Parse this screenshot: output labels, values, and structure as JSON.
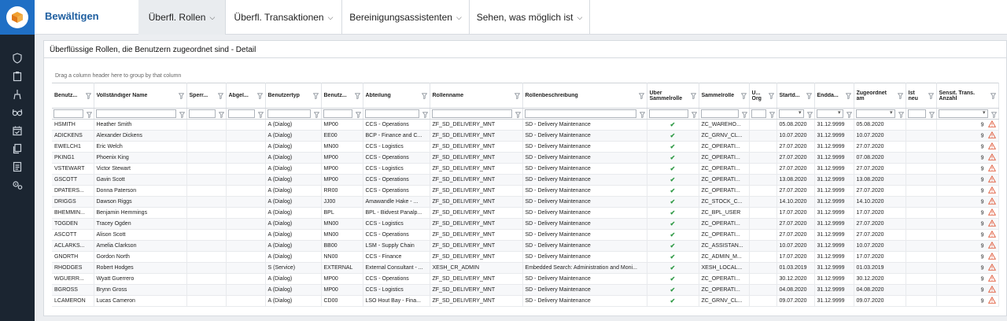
{
  "app": {
    "brand": "Bewältigen"
  },
  "nav": {
    "tabs": [
      {
        "label": "Überfl. Rollen"
      },
      {
        "label": "Überfl. Transaktionen"
      },
      {
        "label": "Bereinigungsassistenten"
      },
      {
        "label": "Sehen, was möglich ist"
      }
    ]
  },
  "sidebar": {
    "icons": [
      "shield-icon",
      "clipboard-icon",
      "broom-icon",
      "glasses-icon",
      "calendar-check-icon",
      "copy-icon",
      "report-icon",
      "gears-icon"
    ]
  },
  "panel": {
    "title": "Überflüssige Rollen, die Benutzern zugeordnet sind - Detail",
    "group_hint": "Drag a column header here to group by that column"
  },
  "table": {
    "columns": [
      {
        "label": "Benutz...",
        "w": 53
      },
      {
        "label": "Vollständiger Name",
        "w": 118
      },
      {
        "label": "Sperr...",
        "w": 50
      },
      {
        "label": "Abgel...",
        "w": 50
      },
      {
        "label": "Benutzertyp",
        "w": 71
      },
      {
        "label": "Benutz...",
        "w": 53
      },
      {
        "label": "Abteilung",
        "w": 85
      },
      {
        "label": "Rollenname",
        "w": 118
      },
      {
        "label": "Rollenbeschreibung",
        "w": 158
      },
      {
        "label": "Über Sammelrolle",
        "w": 66
      },
      {
        "label": "Sammelrolle",
        "w": 64
      },
      {
        "label": "Ü... Org",
        "w": 35
      },
      {
        "label": "Startd...",
        "w": 48
      },
      {
        "label": "Endda...",
        "w": 50
      },
      {
        "label": "Zugeordnet am",
        "w": 66
      },
      {
        "label": "Ist neu",
        "w": 39
      },
      {
        "label": "Sensit. Trans. Anzahl",
        "w": 79
      }
    ],
    "rows": [
      [
        "HSMITH",
        "Heather Smith",
        "",
        "",
        "A (Dialog)",
        "MP00",
        "CCS - Operations",
        "ZF_SD_DELIVERY_MNT",
        "SD - Delivery Maintenance",
        "✔",
        "ZC_WAREHO...",
        "",
        "05.08.2020",
        "31.12.9999",
        "05.08.2020",
        "",
        "9"
      ],
      [
        "ADICKENS",
        "Alexander Dickens",
        "",
        "",
        "A (Dialog)",
        "EE00",
        "BCP - Finance and C...",
        "ZF_SD_DELIVERY_MNT",
        "SD - Delivery Maintenance",
        "✔",
        "ZC_GRNV_CL...",
        "",
        "10.07.2020",
        "31.12.9999",
        "10.07.2020",
        "",
        "9"
      ],
      [
        "EWELCH1",
        "Eric Welch",
        "",
        "",
        "A (Dialog)",
        "MN00",
        "CCS - Logistics",
        "ZF_SD_DELIVERY_MNT",
        "SD - Delivery Maintenance",
        "✔",
        "ZC_OPERATI...",
        "",
        "27.07.2020",
        "31.12.9999",
        "27.07.2020",
        "",
        "9"
      ],
      [
        "PKING1",
        "Phoenix King",
        "",
        "",
        "A (Dialog)",
        "MP00",
        "CCS - Operations",
        "ZF_SD_DELIVERY_MNT",
        "SD - Delivery Maintenance",
        "✔",
        "ZC_OPERATI...",
        "",
        "27.07.2020",
        "31.12.9999",
        "07.08.2020",
        "",
        "9"
      ],
      [
        "VSTEWART",
        "Victor Stewart",
        "",
        "",
        "A (Dialog)",
        "MP00",
        "CCS - Logistics",
        "ZF_SD_DELIVERY_MNT",
        "SD - Delivery Maintenance",
        "✔",
        "ZC_OPERATI...",
        "",
        "27.07.2020",
        "31.12.9999",
        "27.07.2020",
        "",
        "9"
      ],
      [
        "GSCOTT",
        "Gavin Scott",
        "",
        "",
        "A (Dialog)",
        "MP00",
        "CCS - Operations",
        "ZF_SD_DELIVERY_MNT",
        "SD - Delivery Maintenance",
        "✔",
        "ZC_OPERATI...",
        "",
        "13.08.2020",
        "31.12.9999",
        "13.08.2020",
        "",
        "9"
      ],
      [
        "DPATERS...",
        "Donna Paterson",
        "",
        "",
        "A (Dialog)",
        "RR00",
        "CCS - Operations",
        "ZF_SD_DELIVERY_MNT",
        "SD - Delivery Maintenance",
        "✔",
        "ZC_OPERATI...",
        "",
        "27.07.2020",
        "31.12.9999",
        "27.07.2020",
        "",
        "9"
      ],
      [
        "DRIGGS",
        "Dawson Riggs",
        "",
        "",
        "A (Dialog)",
        "JJ00",
        "Amawandle Hake - ...",
        "ZF_SD_DELIVERY_MNT",
        "SD - Delivery Maintenance",
        "✔",
        "ZC_STOCK_C...",
        "",
        "14.10.2020",
        "31.12.9999",
        "14.10.2020",
        "",
        "9"
      ],
      [
        "BHEMMIN...",
        "Benjamin Hemmings",
        "",
        "",
        "A (Dialog)",
        "BPL",
        "BPL - Bidvest Panalp...",
        "ZF_SD_DELIVERY_MNT",
        "SD - Delivery Maintenance",
        "✔",
        "ZC_BPL_USER",
        "",
        "17.07.2020",
        "31.12.9999",
        "17.07.2020",
        "",
        "9"
      ],
      [
        "TOGDEN",
        "Tracey Ogden",
        "",
        "",
        "A (Dialog)",
        "MN00",
        "CCS - Logistics",
        "ZF_SD_DELIVERY_MNT",
        "SD - Delivery Maintenance",
        "✔",
        "ZC_OPERATI...",
        "",
        "27.07.2020",
        "31.12.9999",
        "27.07.2020",
        "",
        "9"
      ],
      [
        "ASCOTT",
        "Alison Scott",
        "",
        "",
        "A (Dialog)",
        "MN00",
        "CCS - Operations",
        "ZF_SD_DELIVERY_MNT",
        "SD - Delivery Maintenance",
        "✔",
        "ZC_OPERATI...",
        "",
        "27.07.2020",
        "31.12.9999",
        "27.07.2020",
        "",
        "9"
      ],
      [
        "ACLARKS...",
        "Amelia Clarkson",
        "",
        "",
        "A (Dialog)",
        "BB00",
        "LSM - Supply Chain",
        "ZF_SD_DELIVERY_MNT",
        "SD - Delivery Maintenance",
        "✔",
        "ZC_ASSISTAN...",
        "",
        "10.07.2020",
        "31.12.9999",
        "10.07.2020",
        "",
        "9"
      ],
      [
        "GNORTH",
        "Gordon North",
        "",
        "",
        "A (Dialog)",
        "NN00",
        "CCS - Finance",
        "ZF_SD_DELIVERY_MNT",
        "SD - Delivery Maintenance",
        "✔",
        "ZC_ADMIN_M...",
        "",
        "17.07.2020",
        "31.12.9999",
        "17.07.2020",
        "",
        "9"
      ],
      [
        "RHODGES",
        "Robert Hodges",
        "",
        "",
        "S (Service)",
        "EXTERNAL",
        "External Consultant - ...",
        "XESH_CR_ADMIN",
        "Embedded Search: Administration and Moni...",
        "✔",
        "XESH_LOCAL...",
        "",
        "01.03.2019",
        "31.12.9999",
        "01.03.2019",
        "",
        "9"
      ],
      [
        "WGUERR...",
        "Wyatt Guerrero",
        "",
        "",
        "A (Dialog)",
        "MP00",
        "CCS - Operations",
        "ZF_SD_DELIVERY_MNT",
        "SD - Delivery Maintenance",
        "✔",
        "ZC_OPERATI...",
        "",
        "30.12.2020",
        "31.12.9999",
        "30.12.2020",
        "",
        "9"
      ],
      [
        "BGROSS",
        "Brynn Gross",
        "",
        "",
        "A (Dialog)",
        "MP00",
        "CCS - Logistics",
        "ZF_SD_DELIVERY_MNT",
        "SD - Delivery Maintenance",
        "✔",
        "ZC_OPERATI...",
        "",
        "04.08.2020",
        "31.12.9999",
        "04.08.2020",
        "",
        "9"
      ],
      [
        "LCAMERON",
        "Lucas Cameron",
        "",
        "",
        "A (Dialog)",
        "CD00",
        "LSO Hout Bay - Fina...",
        "ZF_SD_DELIVERY_MNT",
        "SD - Delivery Maintenance",
        "✔",
        "ZC_GRNV_CL...",
        "",
        "09.07.2020",
        "31.12.9999",
        "09.07.2020",
        "",
        "9"
      ]
    ]
  }
}
